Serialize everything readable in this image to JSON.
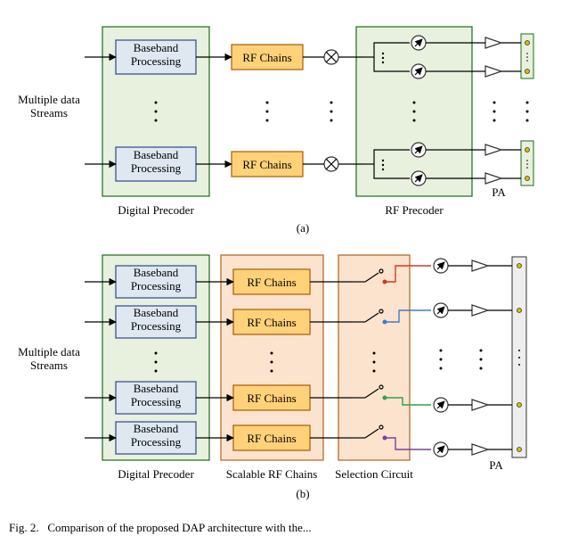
{
  "input_label": "Multiple data\nStreams",
  "baseband_label": "Baseband\nProcessing",
  "rfchain_label": "RF Chains",
  "labels": {
    "digital_precoder": "Digital Precoder",
    "rf_precoder": "RF Precoder",
    "scalable_rf": "Scalable RF Chains",
    "selection_circuit": "Selection Circuit",
    "pa": "PA"
  },
  "sub": {
    "a": "(a)",
    "b": "(b)"
  },
  "caption_prefix": "Fig. 2.",
  "caption_text": "Comparison of the proposed DAP architecture with the..."
}
